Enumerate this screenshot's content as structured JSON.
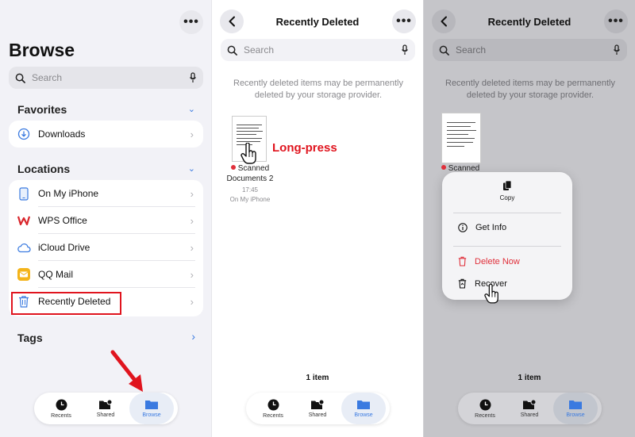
{
  "panel1": {
    "more_label": "•••",
    "title": "Browse",
    "search_placeholder": "Search",
    "favorites": {
      "title": "Favorites",
      "items": [
        {
          "label": "Downloads",
          "icon": "download-circle-icon"
        }
      ]
    },
    "locations": {
      "title": "Locations",
      "items": [
        {
          "label": "On My iPhone",
          "icon": "iphone-icon"
        },
        {
          "label": "WPS Office",
          "icon": "wps-office-icon"
        },
        {
          "label": "iCloud Drive",
          "icon": "icloud-icon"
        },
        {
          "label": "QQ Mail",
          "icon": "qq-mail-icon"
        },
        {
          "label": "Recently Deleted",
          "icon": "trash-icon"
        }
      ]
    },
    "tags_title": "Tags"
  },
  "tabbar": {
    "tabs": [
      "Recents",
      "Shared",
      "Browse"
    ],
    "active": "Browse"
  },
  "panel2": {
    "back_label": "‹",
    "more_label": "•••",
    "title": "Recently Deleted",
    "search_placeholder": "Search",
    "note": "Recently deleted items may be permanently deleted by your storage provider.",
    "file": {
      "name": "Scanned Documents 2",
      "time": "17:45",
      "location": "On My iPhone"
    },
    "annotation": "Long-press",
    "count": "1 item"
  },
  "panel3": {
    "back_label": "‹",
    "more_label": "•••",
    "title": "Recently Deleted",
    "search_placeholder": "Search",
    "note": "Recently deleted items may be permanently deleted by your storage provider.",
    "file_name": "Scanned",
    "menu": {
      "copy": "Copy",
      "get_info": "Get Info",
      "delete_now": "Delete Now",
      "recover": "Recover"
    },
    "count": "1 item"
  },
  "colors": {
    "accent": "#3a7ae0",
    "highlight_box": "#e0141e",
    "arrow": "#e0141e",
    "delete": "#e0303b",
    "annotation": "#e0141e"
  }
}
